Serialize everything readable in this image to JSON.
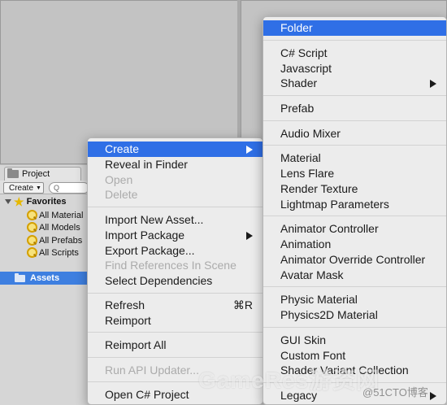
{
  "project_window": {
    "tab_label": "Project",
    "create_label": "Create",
    "search_placeholder": "Q",
    "favorites": {
      "label": "Favorites",
      "items": [
        "All Material",
        "All Models",
        "All Prefabs",
        "All Scripts"
      ]
    },
    "assets_label": "Assets"
  },
  "context_menu": {
    "items": [
      {
        "label": "Create",
        "state": "active",
        "submenu": true
      },
      {
        "label": "Reveal in Finder",
        "state": "enabled"
      },
      {
        "label": "Open",
        "state": "disabled"
      },
      {
        "label": "Delete",
        "state": "disabled"
      },
      {
        "label": "Import New Asset...",
        "state": "enabled"
      },
      {
        "label": "Import Package",
        "state": "enabled",
        "submenu": true
      },
      {
        "label": "Export Package...",
        "state": "enabled"
      },
      {
        "label": "Find References In Scene",
        "state": "disabled"
      },
      {
        "label": "Select Dependencies",
        "state": "enabled"
      },
      {
        "label": "Refresh",
        "state": "enabled",
        "shortcut": "⌘R"
      },
      {
        "label": "Reimport",
        "state": "enabled"
      },
      {
        "label": "Reimport All",
        "state": "enabled"
      },
      {
        "label": "Run API Updater...",
        "state": "disabled"
      },
      {
        "label": "Open C# Project",
        "state": "enabled"
      }
    ]
  },
  "create_submenu": {
    "items": [
      {
        "label": "Folder",
        "state": "active"
      },
      {
        "label": "C# Script",
        "state": "enabled"
      },
      {
        "label": "Javascript",
        "state": "enabled"
      },
      {
        "label": "Shader",
        "state": "enabled",
        "submenu": true
      },
      {
        "label": "Prefab",
        "state": "enabled"
      },
      {
        "label": "Audio Mixer",
        "state": "enabled"
      },
      {
        "label": "Material",
        "state": "enabled"
      },
      {
        "label": "Lens Flare",
        "state": "enabled"
      },
      {
        "label": "Render Texture",
        "state": "enabled"
      },
      {
        "label": "Lightmap Parameters",
        "state": "enabled"
      },
      {
        "label": "Animator Controller",
        "state": "enabled"
      },
      {
        "label": "Animation",
        "state": "enabled"
      },
      {
        "label": "Animator Override Controller",
        "state": "enabled"
      },
      {
        "label": "Avatar Mask",
        "state": "enabled"
      },
      {
        "label": "Physic Material",
        "state": "enabled"
      },
      {
        "label": "Physics2D Material",
        "state": "enabled"
      },
      {
        "label": "GUI Skin",
        "state": "enabled"
      },
      {
        "label": "Custom Font",
        "state": "enabled"
      },
      {
        "label": "Shader Variant Collection",
        "state": "enabled"
      },
      {
        "label": "Legacy",
        "state": "enabled",
        "submenu": true
      }
    ]
  },
  "watermark": {
    "text": "GameRes游资网",
    "subtext": "@51CTO博客"
  },
  "colors": {
    "highlight": "#2f6fe6",
    "menu_bg": "#ececec",
    "disabled_text": "#ababab"
  }
}
